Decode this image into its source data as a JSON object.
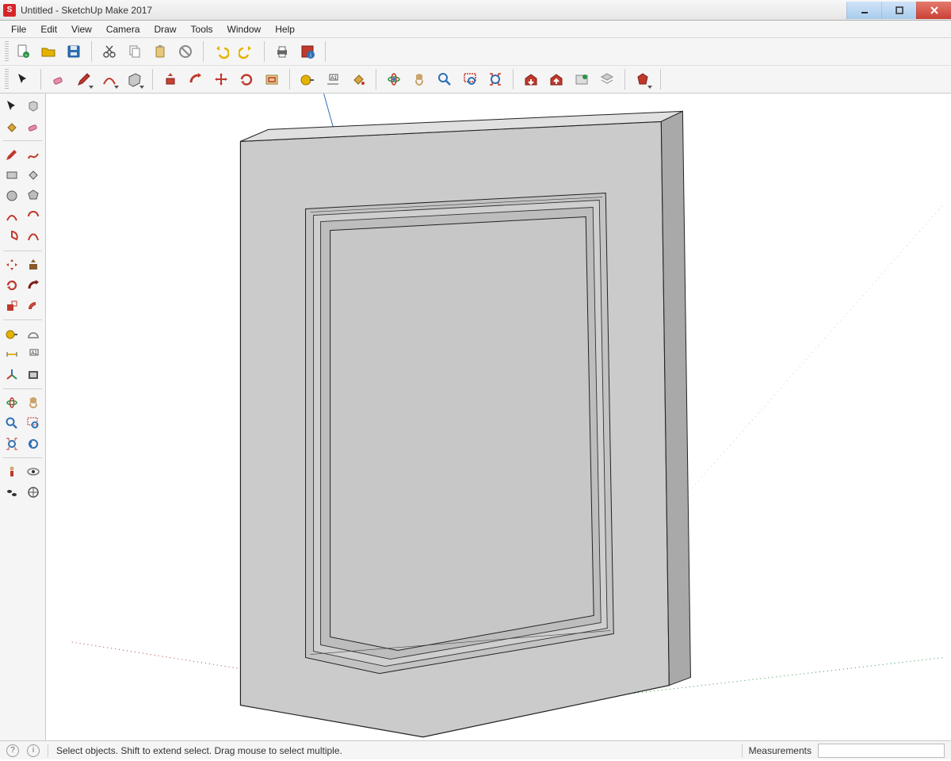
{
  "window": {
    "title": "Untitled - SketchUp Make 2017"
  },
  "menu": {
    "items": [
      "File",
      "Edit",
      "View",
      "Camera",
      "Draw",
      "Tools",
      "Window",
      "Help"
    ]
  },
  "toolbar1": {
    "tools": [
      "new-file",
      "open-file",
      "save-file",
      "cut",
      "copy",
      "paste",
      "delete",
      "undo",
      "redo",
      "print",
      "model-info"
    ]
  },
  "toolbar2": {
    "groups": [
      [
        "select",
        "eraser",
        "pencil",
        "arc",
        "rectangle"
      ],
      [
        "push-pull",
        "follow-me",
        "move",
        "rotate",
        "offset"
      ],
      [
        "tape-measure",
        "dimension",
        "paint-bucket"
      ],
      [
        "orbit",
        "pan",
        "zoom",
        "zoom-window",
        "zoom-extents"
      ],
      [
        "warehouse-get",
        "warehouse-share",
        "extensions",
        "layers"
      ],
      [
        "ruby-console"
      ]
    ]
  },
  "palette": {
    "rows": [
      [
        "select",
        "make-component"
      ],
      [
        "paint-bucket",
        "eraser"
      ],
      [],
      [
        "pencil",
        "freehand"
      ],
      [
        "rectangle",
        "shape-arc"
      ],
      [
        "circle",
        "polygon"
      ],
      [
        "arc-2pt",
        "arc-3pt"
      ],
      [
        "pie",
        "bezier"
      ],
      [],
      [
        "move",
        "push-pull"
      ],
      [
        "rotate",
        "follow-me"
      ],
      [
        "scale",
        "offset"
      ],
      [],
      [
        "tape-measure",
        "protractor"
      ],
      [
        "dimension",
        "text-label"
      ],
      [
        "axes",
        "section-plane"
      ],
      [],
      [
        "orbit",
        "pan"
      ],
      [
        "zoom",
        "zoom-window"
      ],
      [
        "zoom-extents",
        "prev-view"
      ],
      [],
      [
        "position-camera",
        "look-around"
      ],
      [
        "walk",
        "toggle-xray"
      ]
    ]
  },
  "status": {
    "hint": "Select objects. Shift to extend select. Drag mouse to select multiple.",
    "measurements_label": "Measurements"
  }
}
